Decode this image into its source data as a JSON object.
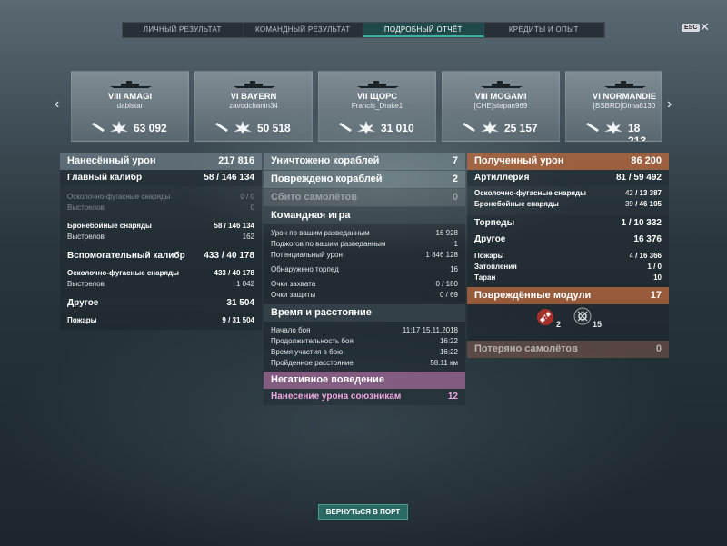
{
  "tabs": [
    {
      "label": "ЛИЧНЫЙ РЕЗУЛЬТАТ"
    },
    {
      "label": "КОМАНДНЫЙ РЕЗУЛЬТАТ"
    },
    {
      "label": "ПОДРОБНЫЙ ОТЧЁТ"
    },
    {
      "label": "КРЕДИТЫ И ОПЫТ"
    }
  ],
  "esc_label": "ESC",
  "esc_close": "✕",
  "ships": [
    {
      "name": "VIII AMAGI",
      "player": "dablstar",
      "value": "63 092"
    },
    {
      "name": "VI BAYERN",
      "player": "zavodchanin34",
      "value": "50 518"
    },
    {
      "name": "VII ЩОРС",
      "player": "Francis_Drake1",
      "value": "31 010"
    },
    {
      "name": "VIII MOGAMI",
      "player": "[CHE]stepan969",
      "value": "25 157"
    },
    {
      "name": "VI NORMANDIE",
      "player": "[BSBRD]Dima8130",
      "value": "18 213"
    }
  ],
  "left": {
    "damage": {
      "label": "Нанесённый урон",
      "value": "217 816"
    },
    "main_caliber": {
      "label": "Главный калибр",
      "value_a": "58",
      "value_b": "146 134"
    },
    "he_shells": {
      "label": "Осколочно-фугасные снаряды",
      "value": "0 / 0"
    },
    "he_shots": {
      "label": "Выстрелов",
      "value": "0"
    },
    "ap_shells": {
      "label": "Бронебойные снаряды",
      "value_a": "58",
      "value_b": "146 134"
    },
    "ap_shots": {
      "label": "Выстрелов",
      "value": "162"
    },
    "secondary": {
      "label": "Вспомогательный калибр",
      "value_a": "433",
      "value_b": "40 178"
    },
    "sec_he": {
      "label": "Осколочно-фугасные снаряды",
      "value_a": "433",
      "value_b": "40 178"
    },
    "sec_shots": {
      "label": "Выстрелов",
      "value": "1 042"
    },
    "other": {
      "label": "Другое",
      "value": "31 504"
    },
    "fires": {
      "label": "Пожары",
      "value_a": "9",
      "value_b": "31 504"
    }
  },
  "middle": {
    "destroyed": {
      "label": "Уничтожено кораблей",
      "value": "7"
    },
    "damaged": {
      "label": "Повреждено кораблей",
      "value": "2"
    },
    "planes": {
      "label": "Сбито самолётов",
      "value": "0"
    },
    "team": {
      "label": "Командная игра"
    },
    "team_rows": [
      {
        "label": "Урон по вашим разведанным",
        "value": "16 928"
      },
      {
        "label": "Поджогов по вашим разведанным",
        "value": "1"
      },
      {
        "label": "Потенциальный урон",
        "value": "1 846 128"
      },
      {
        "label": "Обнаружено торпед",
        "value": "16"
      },
      {
        "label": "Очки захвата",
        "value": "0 / 180"
      },
      {
        "label": "Очки защиты",
        "value": "0 / 69"
      }
    ],
    "time": {
      "label": "Время и расстояние"
    },
    "time_rows": [
      {
        "label": "Начало боя",
        "value": "11:17  15.11.2018"
      },
      {
        "label": "Продолжительность боя",
        "value": "16:22"
      },
      {
        "label": "Время участия в бою",
        "value": "16:22"
      },
      {
        "label": "Пройденное расстояние",
        "value": "58.11 км"
      }
    ],
    "negative": {
      "label": "Негативное поведение"
    },
    "team_damage": {
      "label": "Нанесение урона союзникам",
      "value": "12"
    }
  },
  "right": {
    "received": {
      "label": "Полученный урон",
      "value": "86 200"
    },
    "artillery": {
      "label": "Артиллерия",
      "value_a": "81",
      "value_b": "59 492"
    },
    "he": {
      "label": "Осколочно-фугасные снаряды",
      "value_a": "42",
      "value_b": "13 387"
    },
    "ap": {
      "label": "Бронебойные снаряды",
      "value_a": "39",
      "value_b": "46 105"
    },
    "torpedoes": {
      "label": "Торпеды",
      "value_a": "1",
      "value_b": "10 332"
    },
    "other": {
      "label": "Другое",
      "value": "16 376"
    },
    "fires": {
      "label": "Пожары",
      "value_a": "4",
      "value_b": "16 366"
    },
    "flooding": {
      "label": "Затопления",
      "value": "1 / 0"
    },
    "ram": {
      "label": "Таран",
      "value": "10"
    },
    "modules": {
      "label": "Повреждённые модули",
      "value": "17"
    },
    "module_icons": [
      {
        "icon": "broken-gun-icon",
        "count": "2"
      },
      {
        "icon": "broken-engine-icon",
        "count": "15"
      }
    ],
    "planes_lost": {
      "label": "Потеряно самолётов",
      "value": "0"
    }
  },
  "return_button": "ВЕРНУТЬСЯ В ПОРТ",
  "colors": {
    "accent": "#36b3a9",
    "received_header": "#be693c",
    "negative_header": "#c878b4",
    "button": "#2b6a64"
  }
}
